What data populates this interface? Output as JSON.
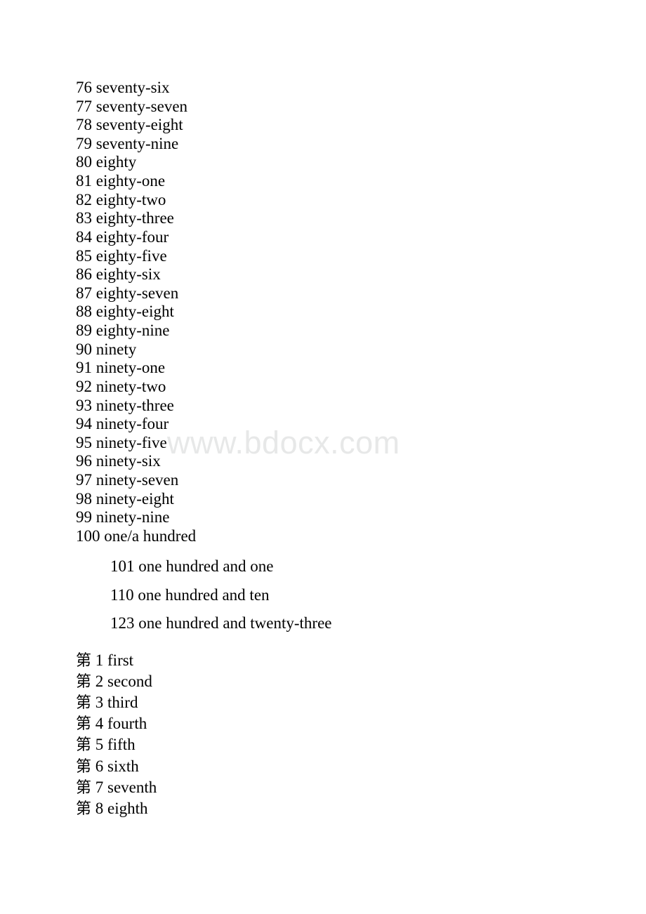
{
  "document": {
    "type": "word-list",
    "background_color": "#ffffff",
    "text_color": "#000000"
  },
  "watermark": {
    "text": "www.bdocx.com",
    "color": "#e7e8e8"
  },
  "sections": {
    "cardinals": {
      "lines": [
        "76 seventy-six",
        "77 seventy-seven",
        "78 seventy-eight",
        "79 seventy-nine",
        "80 eighty",
        "81 eighty-one",
        "82 eighty-two",
        "83 eighty-three",
        "84 eighty-four",
        "85 eighty-five",
        "86 eighty-six",
        "87 eighty-seven",
        "88 eighty-eight",
        "89 eighty-nine",
        "90 ninety",
        "91 ninety-one",
        "92 ninety-two",
        "93 ninety-three",
        "94 ninety-four",
        "95 ninety-five",
        "96 ninety-six",
        "97 ninety-seven",
        "98 ninety-eight",
        "99 ninety-nine",
        "100 one/a hundred"
      ]
    },
    "hundreds_indented": {
      "lines": [
        "101 one hundred and one",
        "110 one hundred and ten",
        "123 one hundred and twenty-three"
      ]
    },
    "ordinals": {
      "prefix": "第",
      "lines": [
        {
          "prefix": "第",
          "rest": " 1 first"
        },
        {
          "prefix": "第",
          "rest": " 2 second"
        },
        {
          "prefix": "第",
          "rest": " 3 third"
        },
        {
          "prefix": "第",
          "rest": " 4 fourth"
        },
        {
          "prefix": "第",
          "rest": " 5 fifth"
        },
        {
          "prefix": "第",
          "rest": " 6 sixth"
        },
        {
          "prefix": "第",
          "rest": " 7 seventh"
        },
        {
          "prefix": "第",
          "rest": " 8 eighth"
        }
      ]
    }
  }
}
